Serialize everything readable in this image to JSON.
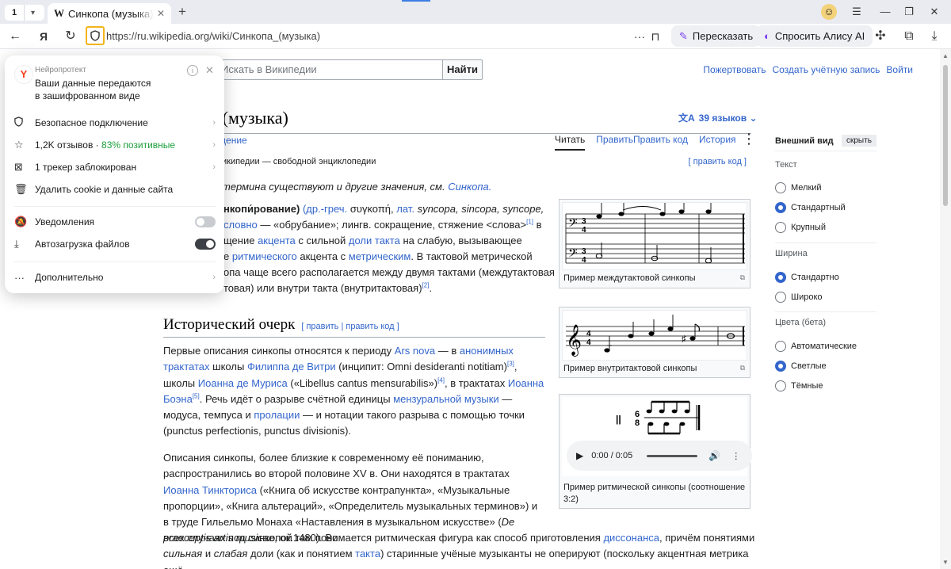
{
  "browser": {
    "tab_count": "1",
    "tab_title": "Синкопа (музыка) — Википедия",
    "tab_favicon": "W",
    "url": "https://ru.wikipedia.org/wiki/Синкопа_(музыка)",
    "retell_label": "Пересказать",
    "ask_alice_label": "Спросить Алису AI"
  },
  "wiki": {
    "search_placeholder": "Искать в Википедии",
    "find_button": "Найти",
    "top_links": [
      "Пожертвовать",
      "Создать учётную запись",
      "Войти"
    ],
    "title_visible": "ка (музыка)",
    "languages": "39 языков",
    "discussion_fragment": "ждение",
    "page_tabs": [
      "Читать",
      "Править",
      "Править код",
      "История"
    ],
    "from_wiki": "икипедии — свободной энциклопедии",
    "edit_source": "[ править код ]",
    "hatnote": "термина существуют и другие значения, см.",
    "hatnote_link": "Синкопа.",
    "intro": {
      "l1a": "нкопи́рование)",
      "l1b": "(др.-греч.",
      "l1c": "συγκοπή,",
      "l1d": "лат.",
      "l1e": "syncopa, sincopa, syncope,",
      "l2a": "словно",
      "l2b": "— «обрубание»; лингв. сокращение, стяжение <слова>",
      "l2sup": "[1]",
      "l2c": "в",
      "l3a": "щение",
      "l3b": "акцента",
      "l3c": "с сильной",
      "l3d": "доли такта",
      "l3e": "на слабую, вызывающее",
      "l4a": "е",
      "l4b": "ритмического",
      "l4c": "акцента с",
      "l4d": "метрическим",
      "l4e": ". В тактовой метрической",
      "l5": "опа чаще всего располагается между двумя тактами (междутактовая",
      "l6": "товая) или внутри такта (внутритактовая)",
      "l6sup": "[2]",
      "l6end": "."
    },
    "section_title": "Исторический очерк",
    "section_edit": "[ править | править код ]",
    "hist_p1": {
      "a": "Первые описания синкопы относятся к периоду",
      "b": "Ars nova",
      "c": "— в",
      "d": "анонимных",
      "e": "трактатах",
      "f": "школы",
      "g": "Филиппа де Витри",
      "h": "(инципит: Omni desideranti notitiam)",
      "s3": "[3]",
      "i": ", школы",
      "j": "Иоанна де Муриса",
      "k": "(«Libellus cantus mensurabilis»)",
      "s4": "[4]",
      "l": ", в трактатах",
      "m": "Иоанна Боэна",
      "s5": "[5]",
      "n": ".",
      "o": "Речь идёт о разрыве счётной единицы",
      "p": "мензуральной музыки",
      "q": "— модуса, темпуса",
      "r": "и",
      "s": "пролации",
      "t": "— и нотации такого разрыва с помощью точки (punctus perfectionis,",
      "u": "punctus divisionis)."
    },
    "hist_p2": {
      "a": "Описания синкопы, более близкие к современному её пониманию,",
      "b": "распространились во второй половине XV в. Они находятся в трактатах",
      "c": "Иоанна",
      "d": "Тинкториса",
      "e": "(«Книга об искусстве контрапункта», «Музыкальные пропорции», «Книга",
      "f": "альтераций», «Определитель музыкальных терминов») и в труде Гильельмо Монаха",
      "g": "«Наставления в музыкальном искусстве» (",
      "h": "De praeceptis artis musicae",
      "i": ", ок.1480). Во",
      "j": "всех случаях под синкопой там понимается ритмическая фигура как способ приготовления",
      "k": "диссонанса",
      "l": ", причём понятиями",
      "m": "сильная",
      "n": "и",
      "o": "слабая",
      "p": "доли (как и понятием",
      "q": "такта",
      "r": ") старинные учёные музыканты не оперируют (поскольку акцентная метрика ещё"
    },
    "figures": {
      "cap1": "Пример междутактовой синкопы",
      "cap2": "Пример внутритактовой синкопы",
      "cap3": "Пример ритмической синкопы (соотношение 3:2)",
      "audio_time": "0:00 / 0:05"
    },
    "appearance": {
      "title": "Внешний вид",
      "hide": "скрыть",
      "text_label": "Текст",
      "text_options": [
        "Мелкий",
        "Стандартный",
        "Крупный"
      ],
      "text_selected": 1,
      "width_label": "Ширина",
      "width_options": [
        "Стандартно",
        "Широко"
      ],
      "width_selected": 0,
      "color_label": "Цвета (бета)",
      "color_options": [
        "Автоматические",
        "Светлые",
        "Тёмные"
      ],
      "color_selected": 1
    }
  },
  "popup": {
    "brand": "Нейропротект",
    "message_line1": "Ваши данные передаются",
    "message_line2": "в зашифрованном виде",
    "secure": "Безопасное подключение",
    "reviews_count": "1,2K отзывов ·",
    "reviews_positive": "83% позитивные",
    "trackers": "1 трекер заблокирован",
    "delete_cookies": "Удалить cookie и данные сайта",
    "notifications": "Уведомления",
    "notifications_on": false,
    "autodownload": "Автозагрузка файлов",
    "autodownload_on": true,
    "more": "Дополнительно",
    "accent": "#1b9e3a"
  }
}
